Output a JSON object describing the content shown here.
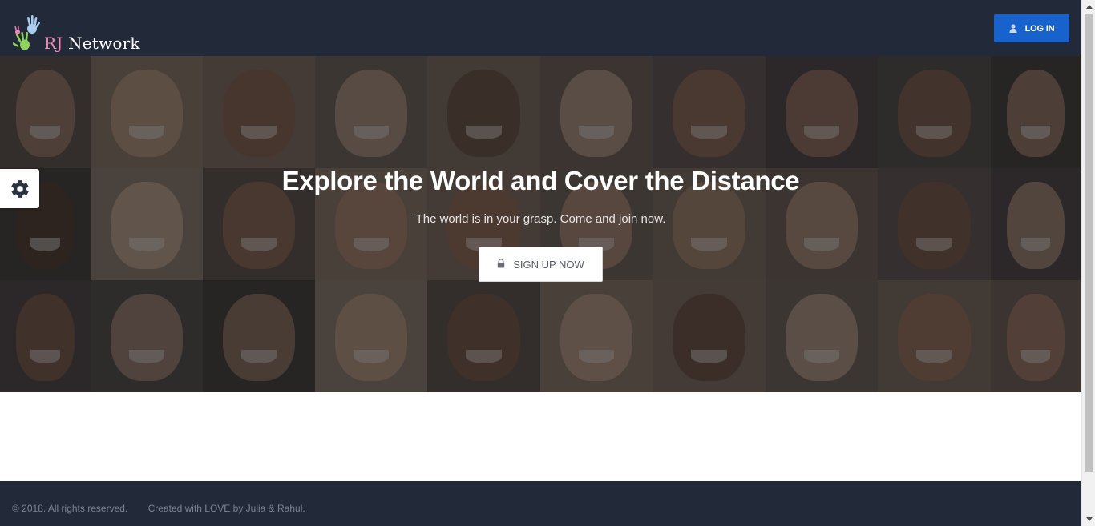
{
  "header": {
    "logo_text": "RJ Network",
    "logo_text_rj": "RJ",
    "logo_text_rest": " Network",
    "login_label": "LOG IN",
    "login_icon": "user-icon",
    "brand_color": "#222a3a",
    "accent_color": "#1762cc"
  },
  "hero": {
    "title": "Explore the World and Cover the Distance",
    "subtitle": "The world is in your grasp. Come and join now.",
    "signup_label": "SIGN UP NOW",
    "signup_icon": "lock-icon",
    "background": "photo-collage-of-smiling-faces"
  },
  "settings": {
    "icon": "gear-icon"
  },
  "footer": {
    "copyright": "© 2018. All rights reserved.",
    "credit": "Created with LOVE by Julia & Rahul."
  }
}
